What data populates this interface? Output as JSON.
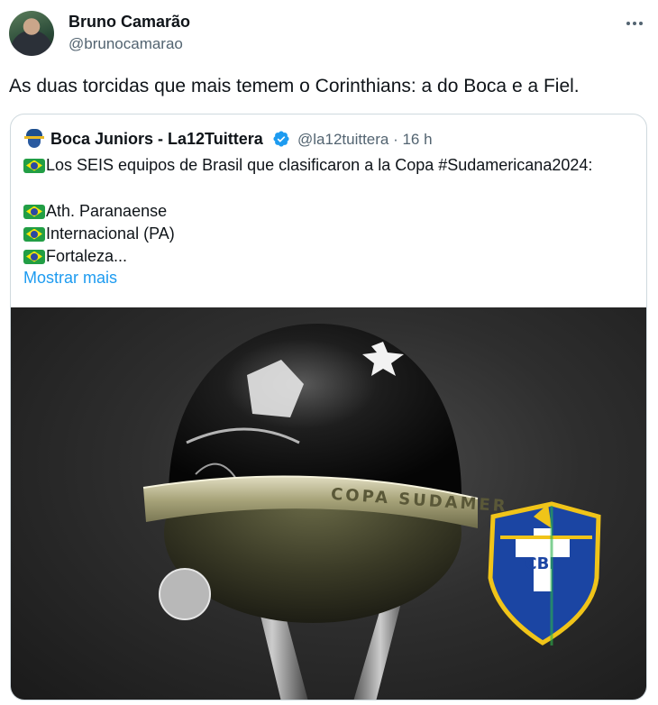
{
  "tweet": {
    "author_name": "Bruno Camarão",
    "author_handle": "@brunocamarao",
    "text": "As duas torcidas que mais temem o Corinthians: a do Boca e a Fiel."
  },
  "quoted_tweet": {
    "author_name": "Boca Juniors - La12Tuittera",
    "author_handle": "@la12tuittera · 16 h",
    "lines": [
      "Los SEIS equipos de Brasil que clasificaron a la Copa #Sudamericana2024:",
      "Ath. Paranaense",
      "Internacional (PA)",
      "Fortaleza..."
    ],
    "show_more_label": "Mostrar mais",
    "image": {
      "trophy_band_text": "COPA SUDAMER",
      "badge_text": "CBF"
    }
  },
  "colors": {
    "link": "#1d9bf0",
    "secondary_text": "#536471",
    "border": "#cfd9de",
    "verified": "#1d9bf0"
  },
  "icons": [
    "more-icon",
    "verified-icon",
    "brazil-flag-icon"
  ]
}
